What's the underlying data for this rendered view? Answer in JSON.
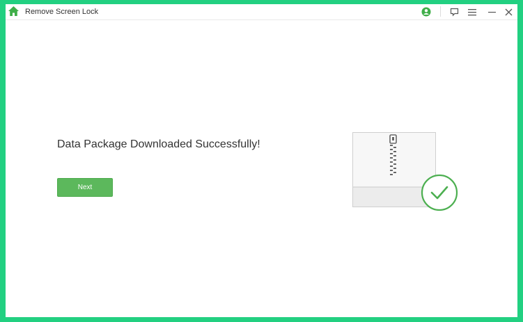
{
  "window": {
    "title": "Remove Screen Lock"
  },
  "titlebar": {
    "icons": [
      "home-icon",
      "account-icon",
      "feedback-icon",
      "menu-icon",
      "minimize-icon",
      "close-icon"
    ]
  },
  "main": {
    "heading": "Data Package Downloaded Successfully!",
    "next_label": "Next",
    "illustration": "zip-package-with-check"
  },
  "colors": {
    "frame": "#22d081",
    "accent": "#5cb85c",
    "check": "#4caf50"
  }
}
